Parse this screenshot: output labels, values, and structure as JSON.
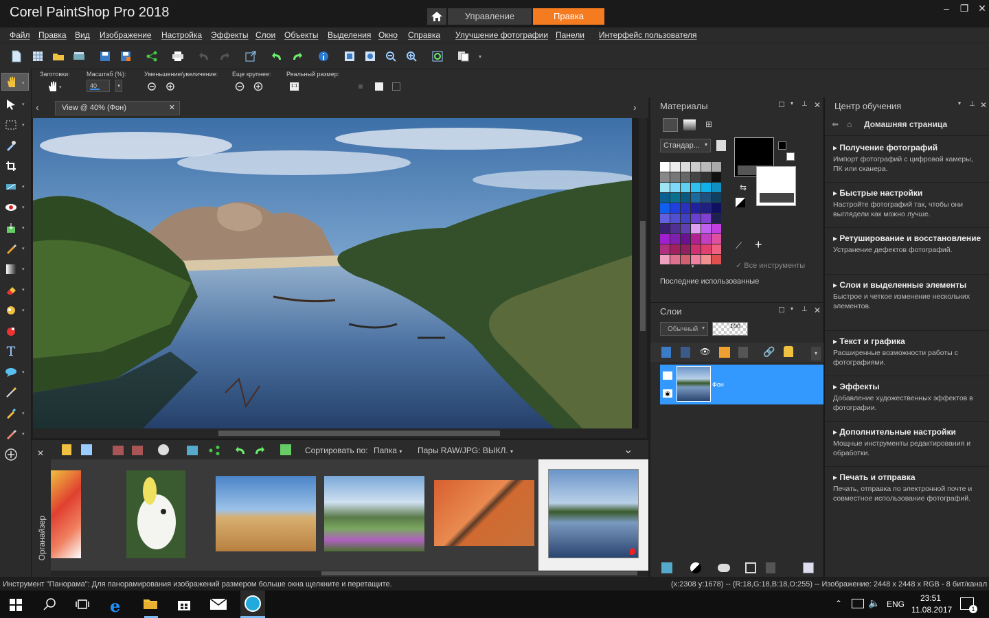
{
  "app": {
    "title": "Corel PaintShop Pro 2018"
  },
  "workspace_tabs": {
    "manage": "Управление",
    "edit": "Правка"
  },
  "menu": [
    "Файл",
    "Правка",
    "Вид",
    "Изображение",
    "Настройка",
    "Эффекты",
    "Слои",
    "Объекты",
    "Выделения",
    "Окно",
    "Справка",
    "Улучшение фотографии",
    "Панели",
    "Интерфейс пользователя"
  ],
  "options": {
    "presets_label": "Заготовки:",
    "zoom_label": "Масштаб (%):",
    "zoom_value": "40",
    "zoom_inout_label": "Уменьшение/увеличение:",
    "zoom_more_label": "Еще крупнее:",
    "actual_size_label": "Реальный размер:"
  },
  "document": {
    "tab_label": "View @  40% (Фон)"
  },
  "organizer": {
    "label": "Органайзер",
    "sort_label": "Сортировать по:",
    "sort_value": "Папка",
    "raw_pairs": "Пары RAW/JPG: ВЫКЛ."
  },
  "materials": {
    "title": "Материалы",
    "palette_select": "Стандар...",
    "all_tools": "Все инструменты",
    "recent": "Последние использованные",
    "swatches": [
      "#ffffff",
      "#eeeeee",
      "#dddddd",
      "#cccccc",
      "#bbbbbb",
      "#aaaaaa",
      "#888888",
      "#777777",
      "#666666",
      "#444444",
      "#333333",
      "#111111",
      "#9fe5f5",
      "#7fd8f5",
      "#5fd0f0",
      "#2fc0f0",
      "#10b0e8",
      "#1090c0",
      "#0a6090",
      "#0a7090",
      "#0a5a80",
      "#1a6aa0",
      "#205080",
      "#104060",
      "#1060f0",
      "#2040e0",
      "#2a30c0",
      "#2020a0",
      "#202080",
      "#101060",
      "#6060e0",
      "#5050d0",
      "#4040c0",
      "#6a40d0",
      "#8040d0",
      "#202050",
      "#3a2070",
      "#503090",
      "#6040b0",
      "#e0a0f0",
      "#c060f0",
      "#c040e0",
      "#a020d0",
      "#8020b0",
      "#6a1090",
      "#b02090",
      "#c040c0",
      "#e050a0",
      "#b03080",
      "#a02060",
      "#902060",
      "#d03070",
      "#e04070",
      "#f06080",
      "#f0a0c0",
      "#e07090",
      "#d06070",
      "#f080a0",
      "#f09090",
      "#e05050"
    ]
  },
  "layers": {
    "title": "Слои",
    "blend_mode": "Обычный",
    "opacity": "100",
    "layer_name": "Фон"
  },
  "learning": {
    "title": "Центр обучения",
    "home": "Домашняя страница",
    "sections": [
      {
        "h": "Получение фотографий",
        "d": "Импорт фотографий с цифровой камеры, ПК или сканера."
      },
      {
        "h": "Быстрые настройки",
        "d": "Настройте фотографий так, чтобы они выглядели как можно лучше."
      },
      {
        "h": "Ретуширование и восстановление",
        "d": "Устранение дефектов фотографий."
      },
      {
        "h": "Слои и выделенные элементы",
        "d": "Быстрое и четкое изменение нескольких элементов."
      },
      {
        "h": "Текст и графика",
        "d": "Расширенные возможности работы с фотографиями."
      },
      {
        "h": "Эффекты",
        "d": "Добавление художественных эффектов в фотографии."
      },
      {
        "h": "Дополнительные настройки",
        "d": "Мощные инструменты редактирования и обработки."
      },
      {
        "h": "Печать и отправка",
        "d": "Печать, отправка по электронной почте и совместное использование фотографий."
      }
    ]
  },
  "status": {
    "left": "Инструмент \"Панорама\": Для панорамирования изображений размером больше окна щелкните и перетащите.",
    "right": "(x:2308 y:1678) -- (R:18,G:18,B:18,O:255) -- Изображение:  2448 x 2448 x RGB - 8 бит/канал"
  },
  "taskbar": {
    "lang": "ENG",
    "time": "23:51",
    "date": "11.08.2017",
    "notifications": "1"
  }
}
